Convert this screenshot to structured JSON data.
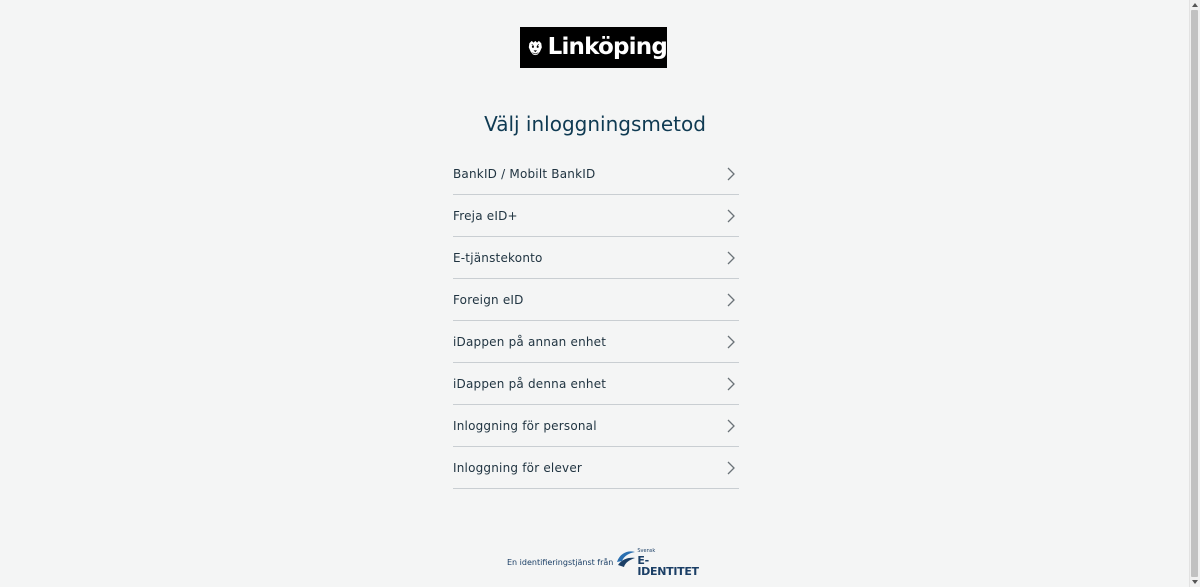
{
  "logo": {
    "text": "Linköping",
    "emblem": "lion-emblem-icon"
  },
  "heading": "Välj inloggningsmetod",
  "methods": [
    {
      "label": "BankID / Mobilt BankID"
    },
    {
      "label": "Freja eID+"
    },
    {
      "label": "E-tjänstekonto"
    },
    {
      "label": "Foreign eID"
    },
    {
      "label": "iDappen på annan enhet"
    },
    {
      "label": "iDappen på denna enhet"
    },
    {
      "label": "Inloggning för personal"
    },
    {
      "label": "Inloggning för elever"
    }
  ],
  "footer": {
    "text": "En identifieringstjänst från",
    "brand_small": "Svensk",
    "brand_big": "E-IDENTITET"
  },
  "colors": {
    "background": "#f4f5f5",
    "heading": "#0f3a52",
    "divider": "#c9ced2",
    "brand_blue": "#1b3f66"
  }
}
